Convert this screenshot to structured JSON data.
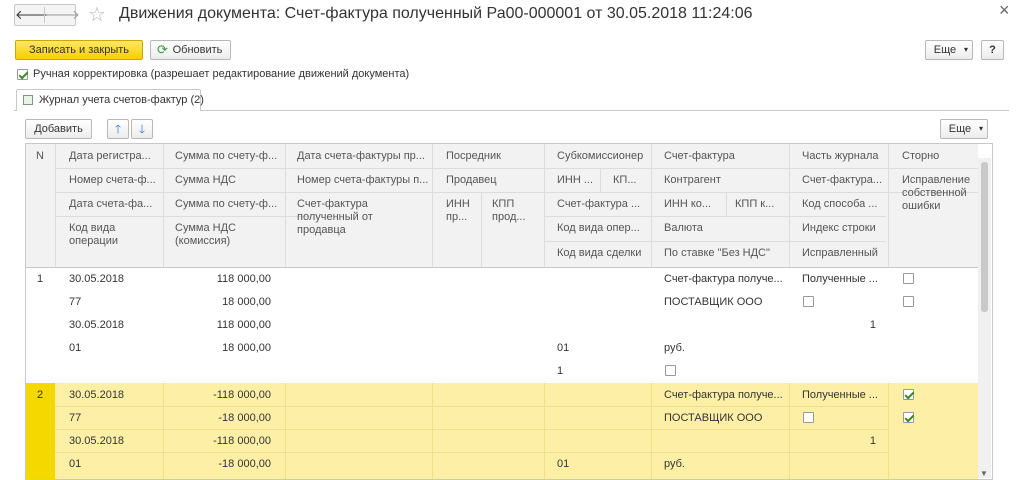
{
  "window": {
    "title": "Движения документа: Счет-фактура полученный Ра00-000001 от 30.05.2018 11:24:06",
    "back_glyph": "🡐",
    "forward_glyph": "🡒",
    "star_glyph": "☆",
    "close_glyph": "×"
  },
  "toolbar": {
    "save_close_label": "Записать и закрыть",
    "refresh_label": "Обновить",
    "more_label": "Еще",
    "help_label": "?"
  },
  "manual_correction": {
    "label": "Ручная корректировка (разрешает редактирование движений документа)",
    "checked": true
  },
  "tab": {
    "label": "Журнал учета счетов-фактур (2)"
  },
  "grid_toolbar": {
    "add_label": "Добавить",
    "more_label": "Еще"
  },
  "columns": {
    "n": "N",
    "c1": [
      "Дата регистра...",
      "Номер счета-ф...",
      "Дата счета-фа...",
      "Код вида операции"
    ],
    "c2": [
      "Сумма по счету-ф...",
      "Сумма НДС",
      "Сумма по счету-ф...",
      "Сумма НДС (комиссия)"
    ],
    "c3": [
      "Дата счета-фактуры пр...",
      "Номер счета-фактуры п...",
      "Счет-фактура полученный от продавца"
    ],
    "c4": [
      "Посредник",
      "Продавец"
    ],
    "c4a": "ИНН пр...",
    "c4b": "КПП прод...",
    "c5": [
      "Субкомиссионер",
      "Счет-фактура ...",
      "Код вида опер...",
      "Код вида сделки"
    ],
    "c5a": "ИНН ...",
    "c5b": "КП...",
    "c6": [
      "Счет-фактура",
      "Контрагент",
      "Валюта",
      "По ставке \"Без НДС\""
    ],
    "c6a": "ИНН ко...",
    "c6b": "КПП к...",
    "c7": [
      "Часть журнала",
      "Счет-фактура...",
      "Код способа ...",
      "Индекс строки",
      "Исправленный"
    ],
    "c8": [
      "Сторно",
      "Исправление собственной ошибки"
    ]
  },
  "rows": [
    {
      "n": "1",
      "date_reg": "30.05.2018",
      "num_sf": "77",
      "date_sf": "30.05.2018",
      "op_code": "01",
      "sum_sf": "118 000,00",
      "sum_nds": "18 000,00",
      "sum_sf2": "118 000,00",
      "sum_nds_comm": "18 000,00",
      "op_kind": "01",
      "deal_code": "1",
      "invoice": "Счет-фактура получе...",
      "counterparty": "ПОСТАВЩИК ООО",
      "currency": "руб.",
      "journal_part": "Полученные ...",
      "line_index": "1",
      "storno": false,
      "own_error": false,
      "invoice_chk": false,
      "corrected": false,
      "no_vat": false
    },
    {
      "n": "2",
      "date_reg": "30.05.2018",
      "num_sf": "77",
      "date_sf": "30.05.2018",
      "op_code": "01",
      "sum_sf": "-118 000,00",
      "sum_nds": "-18 000,00",
      "sum_sf2": "-118 000,00",
      "sum_nds_comm": "-18 000,00",
      "op_kind": "01",
      "invoice": "Счет-фактура получе...",
      "counterparty": "ПОСТАВЩИК ООО",
      "currency": "руб.",
      "journal_part": "Полученные ...",
      "line_index": "1",
      "storno": true,
      "own_error": true,
      "invoice_chk": false
    }
  ],
  "colors": {
    "accent_yellow": "#fdf0a6",
    "selected_yellow": "#f5d800",
    "button_yellow": "#f5d000"
  }
}
